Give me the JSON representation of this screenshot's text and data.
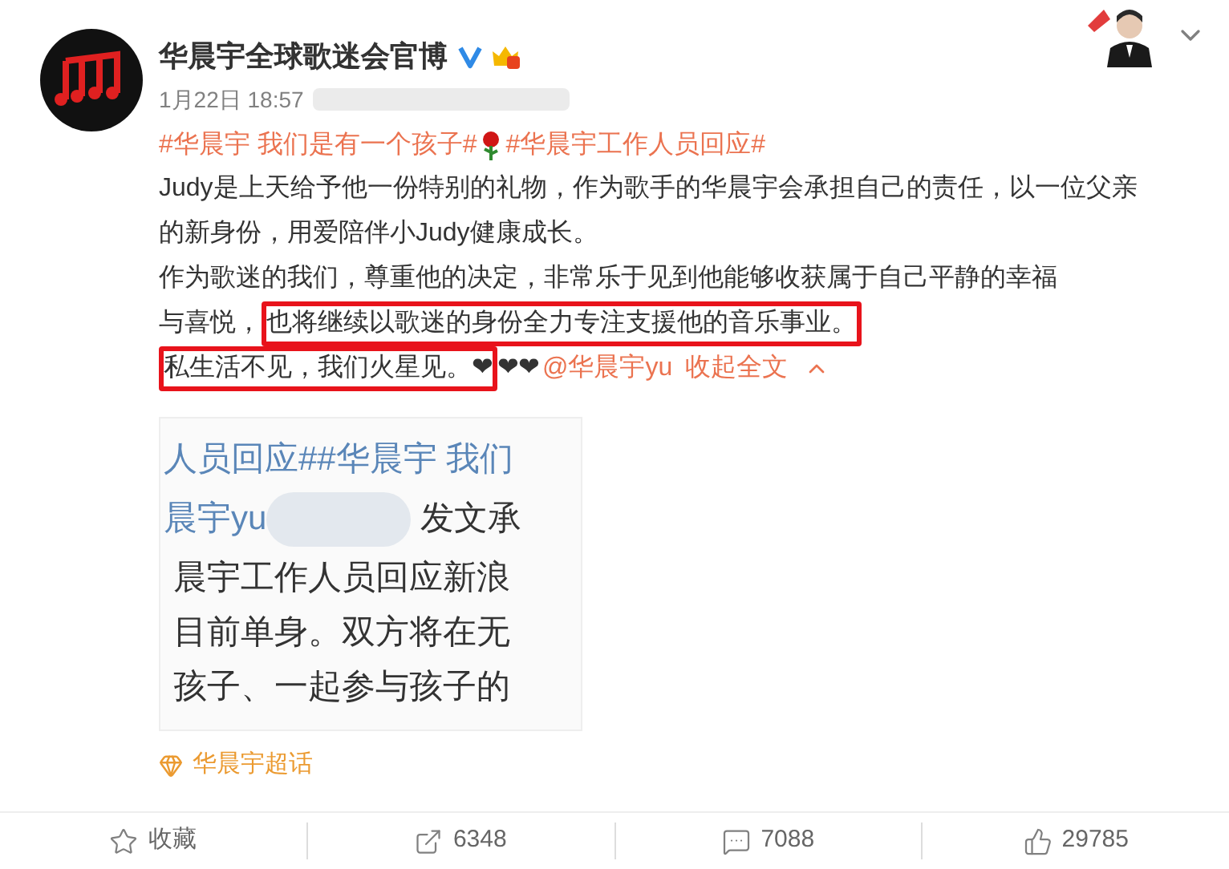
{
  "post": {
    "author": "华晨宇全球歌迷会官博",
    "time": "1月22日 18:57",
    "tags": [
      {
        "kind": "link",
        "text": "#华晨宇 我们是有一个孩子#"
      },
      {
        "kind": "rose"
      },
      {
        "kind": "link",
        "text": "#华晨宇工作人员回应#"
      }
    ],
    "paragraphs": [
      [
        {
          "kind": "text",
          "text": "Judy是上天给予他一份特别的礼物，作为歌手的华晨宇会承担自己的责任，以一位父亲的新身份，用爱陪伴小Judy健康成长。",
          "highlighted": false
        }
      ],
      [
        {
          "kind": "text",
          "text": "作为歌迷的我们，尊重他的决定，非常乐于见到他能够收获属于自己平静的幸福",
          "highlighted": false
        },
        {
          "kind": "text",
          "text": "与喜悦，",
          "highlighted": false
        },
        {
          "kind": "text",
          "text": "也将继续以歌迷的身份全力专注支援他的音乐事业。",
          "highlighted": true
        }
      ],
      [
        {
          "kind": "text",
          "text": "私生活不见，我们火星见。❤",
          "highlighted": true
        },
        {
          "kind": "text",
          "text": "❤❤",
          "highlighted": false
        },
        {
          "kind": "link",
          "text": "@华晨宇yu"
        },
        {
          "kind": "link",
          "text": "收起全文"
        },
        {
          "kind": "caret"
        }
      ]
    ],
    "image_lines": [
      [
        {
          "text": "人员回应##华晨宇 我们",
          "kind": "link"
        }
      ],
      [
        {
          "text": "晨宇yu",
          "kind": "link"
        },
        {
          "kind": "blur"
        },
        {
          "text": "发文承",
          "kind": "text"
        }
      ],
      [
        {
          "text": "晨宇工作人员回应新浪",
          "kind": "text"
        }
      ],
      [
        {
          "text": "目前单身。双方将在无",
          "kind": "text"
        }
      ],
      [
        {
          "text": "孩子、一起参与孩子的",
          "kind": "text"
        }
      ]
    ],
    "topic": "华晨宇超话",
    "actions": [
      {
        "kind": "favorite",
        "label": "收藏"
      },
      {
        "kind": "repost",
        "label": "6348"
      },
      {
        "kind": "comment",
        "label": "7088"
      },
      {
        "kind": "like",
        "label": "29785"
      }
    ]
  }
}
